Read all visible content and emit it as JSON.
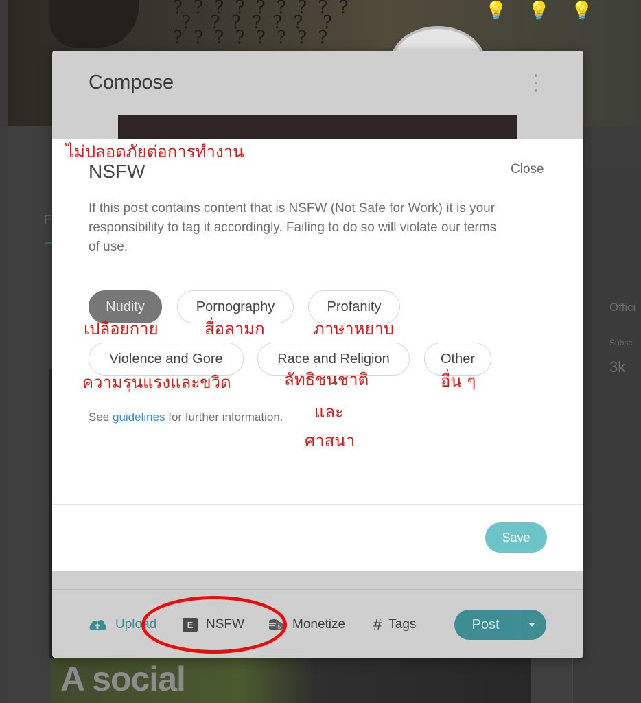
{
  "background": {
    "banner_doodle": "? ? ? ? ? ? ? ? ?\n ?  ? ? ? ? ?  ?\n? ? ? ? ? ? ? ?",
    "tab_letter": "F",
    "sidebar": {
      "official": "Offici",
      "subscribers_label": "Subsc",
      "subscribers_count": "3k"
    },
    "post_preview_text": "A social"
  },
  "compose": {
    "title": "Compose",
    "toolbar": {
      "upload": "Upload",
      "nsfw": "NSFW",
      "nsfw_icon_letter": "E",
      "monetize": "Monetize",
      "tags": "Tags",
      "tags_symbol": "#",
      "post": "Post"
    }
  },
  "nsfw_dialog": {
    "title": "NSFW",
    "close": "Close",
    "description": "If this post contains content that is NSFW (Not Safe for Work) it is your responsibility to tag it accordingly. Failing to do so will violate our terms of use.",
    "categories": [
      {
        "label": "Nudity",
        "selected": true
      },
      {
        "label": "Pornography",
        "selected": false
      },
      {
        "label": "Profanity",
        "selected": false
      },
      {
        "label": "Violence and Gore",
        "selected": false
      },
      {
        "label": "Race and Religion",
        "selected": false
      },
      {
        "label": "Other",
        "selected": false
      }
    ],
    "guidelines_prefix": "See",
    "guidelines_link": "guidelines",
    "guidelines_suffix": "for further information.",
    "save": "Save"
  },
  "annotations": {
    "title_th": "ไม่ปลอดภัยต่อการทำงาน",
    "nudity_th": "เปลือยกาย",
    "pornography_th": "สื่อลามก",
    "profanity_th": "ภาษาหยาบ",
    "violence_th": "ความรุนแรงและขวิด",
    "race_th_1": "ลัทธิชนชาติ",
    "race_th_2": "และ",
    "race_th_3": "ศาสนา",
    "other_th": "อื่น ๆ",
    "color": "#d41c1c"
  },
  "colors": {
    "accent_teal": "#6cc4c8",
    "post_teal": "#3d8d93",
    "link_blue": "#3a8fd0",
    "selected_chip": "#777777",
    "highlight_red": "#ec0c0c"
  }
}
